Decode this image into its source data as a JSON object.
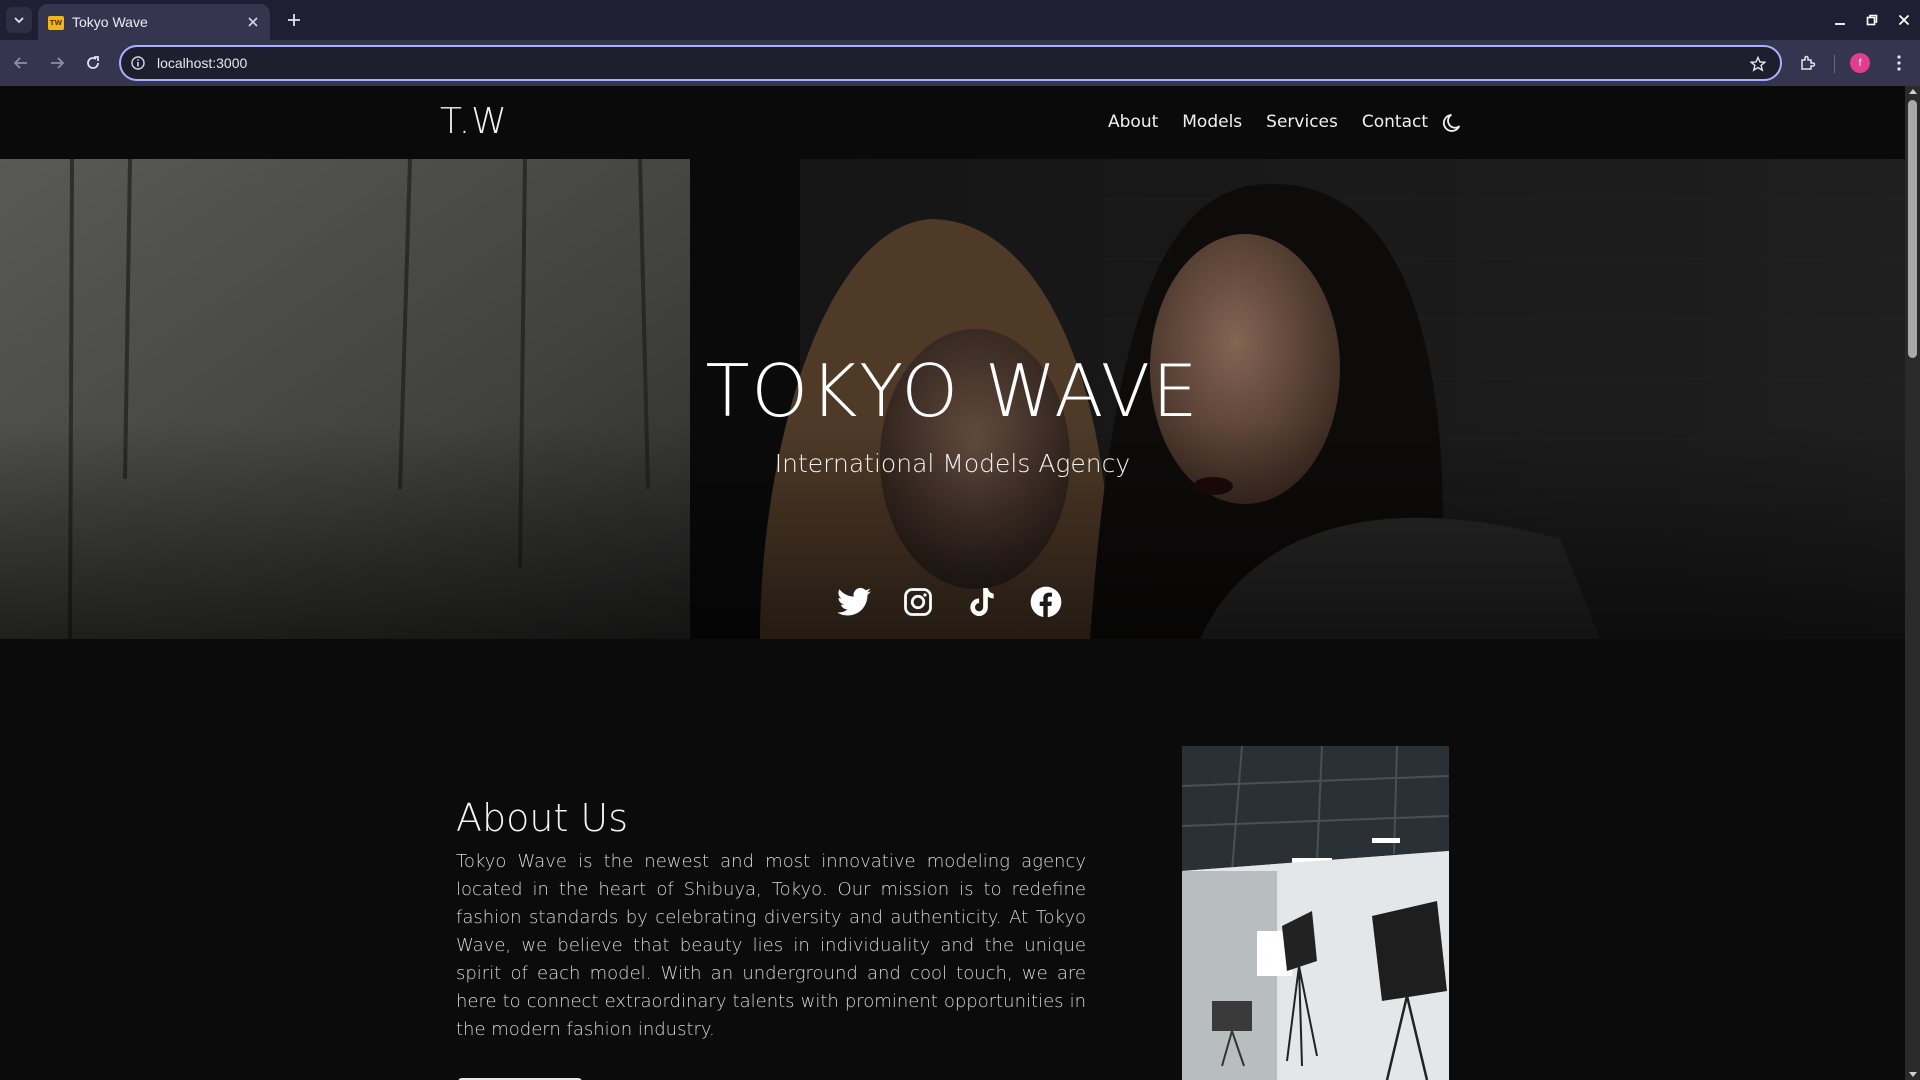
{
  "browser": {
    "tab": {
      "favicon_text": "TW",
      "title": "Tokyo Wave"
    },
    "address": {
      "url": "localhost:3000"
    },
    "profile_initial": "f"
  },
  "site": {
    "logo": "T.W",
    "nav": [
      "About",
      "Models",
      "Services",
      "Contact"
    ],
    "hero": {
      "title": "TOKYO WAVE",
      "subtitle": "International Models Agency",
      "socials": [
        "twitter-icon",
        "instagram-icon",
        "tiktok-icon",
        "facebook-icon"
      ]
    },
    "about": {
      "heading": "About Us",
      "text": "Tokyo Wave is the newest and most innovative modeling agency located in the heart of Shibuya, Tokyo. Our mission is to redefine fashion standards by celebrating diversity and authenticity. At Tokyo Wave, we believe that beauty lies in individuality and the unique spirit of each model. With an underground and cool touch, we are here to connect extraordinary talents with prominent opportunities in the modern fashion industry."
    }
  },
  "colors": {
    "chrome_tabbar": "#1f1f33",
    "chrome_toolbar": "#35354f",
    "omnibox_focus": "#a8b1ff",
    "page_background": "#0b0b0c",
    "profile_avatar": "#e23d8e",
    "favicon": "#f2b619"
  }
}
